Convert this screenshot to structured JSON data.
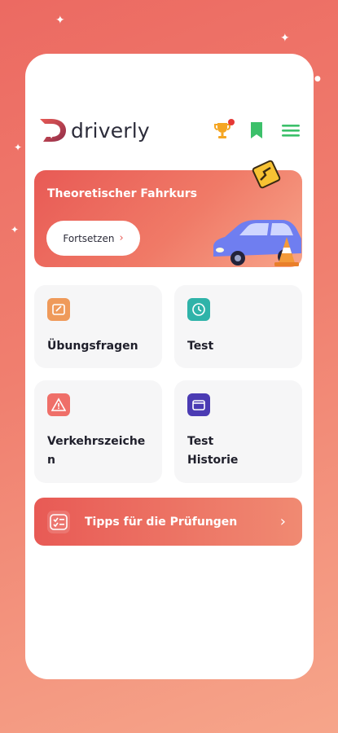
{
  "app": {
    "name": "driverly",
    "colors": {
      "accent": "#e85a55",
      "brand_dark": "#2c2c3a",
      "icon_green": "#3cc06a",
      "trophy": "#f5a623"
    }
  },
  "header": {
    "icons": [
      "trophy-icon",
      "bookmark-icon",
      "menu-icon"
    ]
  },
  "hero": {
    "title": "Theoretischer Fahrkurs",
    "button_label": "Fortsetzen",
    "button_chevron": "›"
  },
  "tiles": [
    {
      "label": "Übungsfragen",
      "icon": "edit-icon",
      "color": "#ef9a5a"
    },
    {
      "label": "Test",
      "icon": "clock-icon",
      "color": "#2fb3a9"
    },
    {
      "label_line1": "Verkehrszeiche",
      "label_line2": "n",
      "icon": "warning-icon",
      "color": "#ef6f69"
    },
    {
      "label_line1": "Test",
      "label_line2": "Historie",
      "icon": "folder-icon",
      "color": "#4b3bb3"
    }
  ],
  "tips": {
    "label": "Tipps für die Prüfungen",
    "icon": "checklist-icon",
    "chevron": "›"
  }
}
